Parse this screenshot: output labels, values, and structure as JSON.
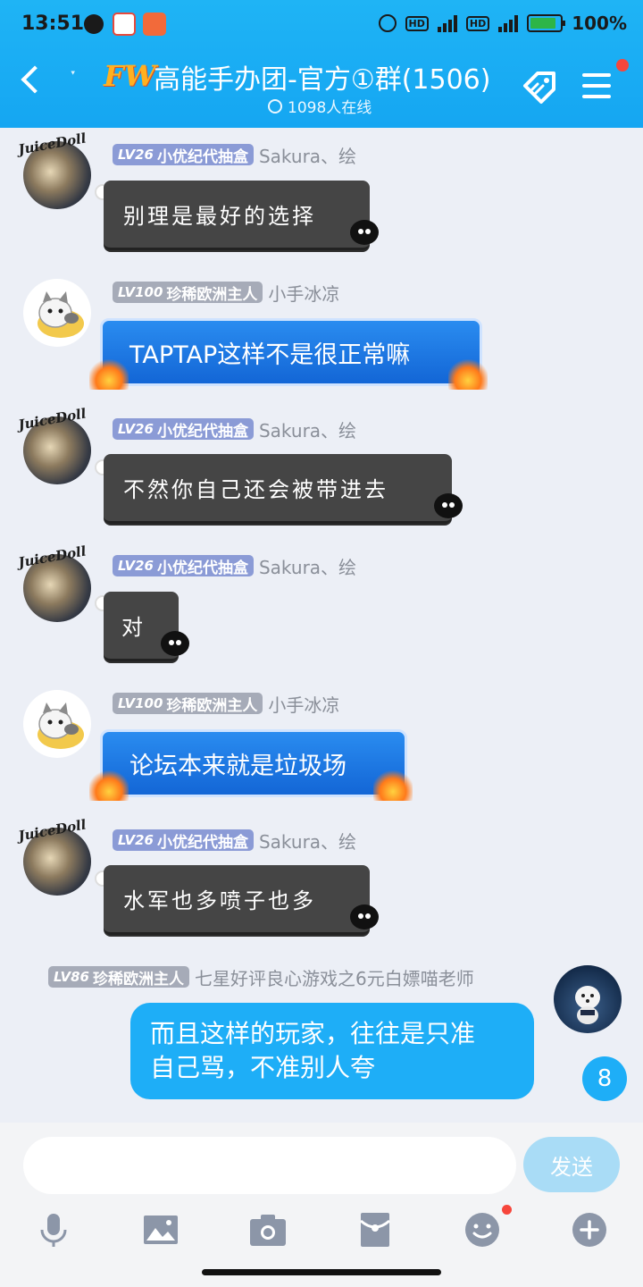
{
  "status_bar": {
    "time": "13:51",
    "battery": "100%",
    "network": "4G",
    "hd": "HD"
  },
  "header": {
    "badge_text": "FW",
    "title": "高能手办团-官方①群(1506)",
    "online": "1098人在线"
  },
  "messages": [
    {
      "level": "LV26",
      "title": "小优纪代抽盒",
      "nick": "Sakura、绘",
      "text": "别理是最好的选择",
      "style": "dark"
    },
    {
      "level": "LV100",
      "title": "珍稀欧洲主人",
      "nick": "小手冰凉",
      "text": "TAPTAP这样不是很正常嘛",
      "style": "blue"
    },
    {
      "level": "LV26",
      "title": "小优纪代抽盒",
      "nick": "Sakura、绘",
      "text": "不然你自己还会被带进去",
      "style": "dark"
    },
    {
      "level": "LV26",
      "title": "小优纪代抽盒",
      "nick": "Sakura、绘",
      "text": "对",
      "style": "dark"
    },
    {
      "level": "LV100",
      "title": "珍稀欧洲主人",
      "nick": "小手冰凉",
      "text": "论坛本来就是垃圾场",
      "style": "blue"
    },
    {
      "level": "LV26",
      "title": "小优纪代抽盒",
      "nick": "Sakura、绘",
      "text": "水军也多喷子也多",
      "style": "dark"
    },
    {
      "level": "LV86",
      "title": "珍稀欧洲主人",
      "nick": "七星好评良心游戏之6元白嫖喵老师",
      "text_line1": "而且这样的玩家，往往是只准",
      "text_line2": "自己骂，不准别人夸",
      "style": "mine"
    }
  ],
  "avatar_tag": "JuiceDoll",
  "unread_count": "8",
  "input": {
    "placeholder": "",
    "send_label": "发送"
  },
  "toolbar": [
    "mic-icon",
    "image-icon",
    "camera-icon",
    "red-packet-icon",
    "emoji-icon",
    "plus-icon"
  ],
  "colors": {
    "header": "#18aaf3",
    "bubble_mine": "#1eaef7",
    "bubble_dark": "#454545",
    "bubble_blue": "#1a75e0"
  }
}
